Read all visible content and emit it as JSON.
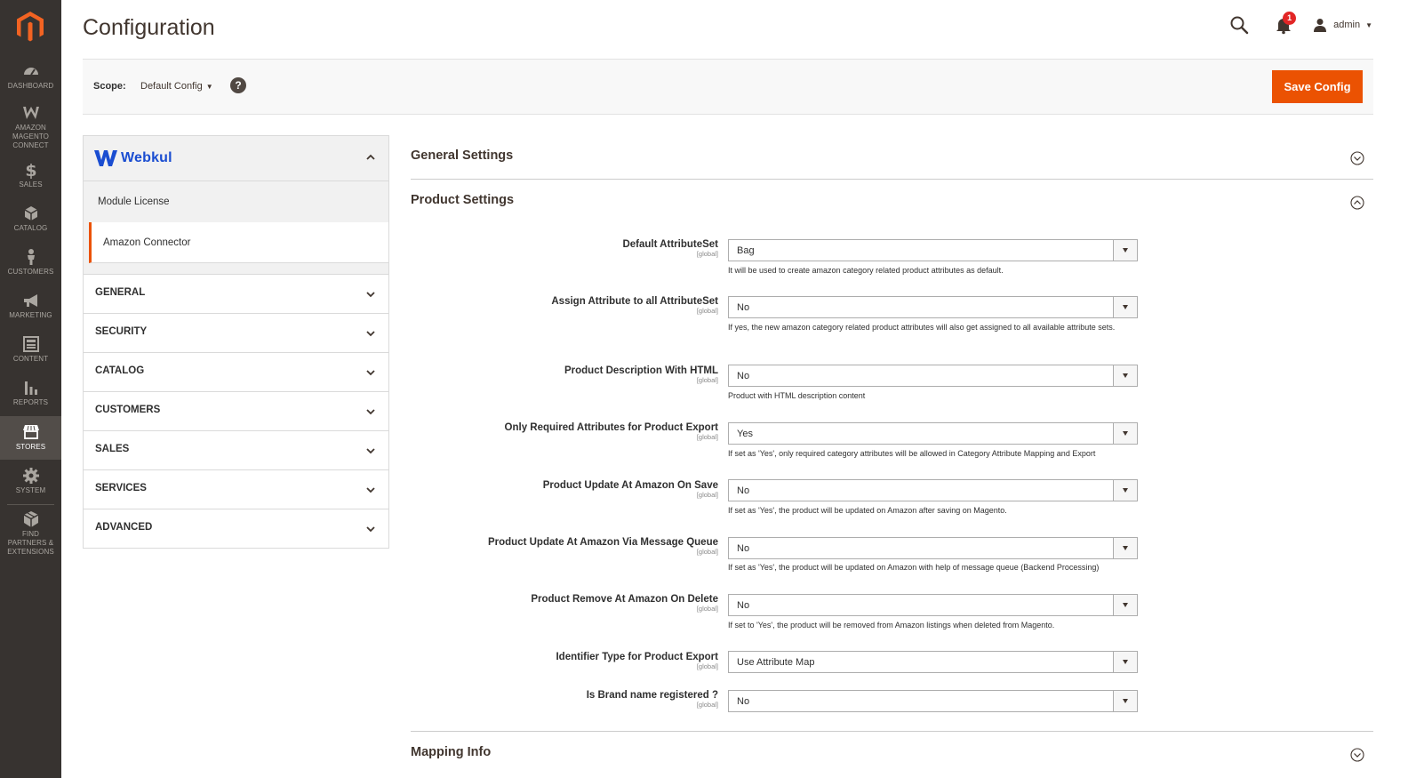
{
  "page": {
    "title": "Configuration"
  },
  "admin_menu": [
    {
      "key": "dashboard",
      "label": "DASHBOARD",
      "icon": "dashboard-icon"
    },
    {
      "key": "amazon",
      "label": "AMAZON MAGENTO CONNECT",
      "icon": "amazon-connect-icon"
    },
    {
      "key": "sales",
      "label": "SALES",
      "icon": "dollar-icon"
    },
    {
      "key": "catalog",
      "label": "CATALOG",
      "icon": "box-icon"
    },
    {
      "key": "customers",
      "label": "CUSTOMERS",
      "icon": "person-icon"
    },
    {
      "key": "marketing",
      "label": "MARKETING",
      "icon": "megaphone-icon"
    },
    {
      "key": "content",
      "label": "CONTENT",
      "icon": "content-icon"
    },
    {
      "key": "reports",
      "label": "REPORTS",
      "icon": "bar-chart-icon"
    },
    {
      "key": "stores",
      "label": "STORES",
      "icon": "store-icon",
      "active": true
    },
    {
      "key": "system",
      "label": "SYSTEM",
      "icon": "gear-icon"
    },
    {
      "key": "partners",
      "label": "FIND PARTNERS & EXTENSIONS",
      "icon": "extensions-icon"
    }
  ],
  "header": {
    "notifications_count": "1",
    "user_name": "admin"
  },
  "scope": {
    "label": "Scope:",
    "value": "Default Config",
    "help": "?",
    "save_label": "Save Config"
  },
  "tabs": {
    "brand": "Webkul",
    "sub_items": [
      "Module License",
      "Amazon Connector"
    ],
    "active_sub_item": "Amazon Connector",
    "sections": [
      "GENERAL",
      "SECURITY",
      "CATALOG",
      "CUSTOMERS",
      "SALES",
      "SERVICES",
      "ADVANCED"
    ]
  },
  "main": {
    "general_settings": "General Settings",
    "product_settings": "Product Settings",
    "mapping_info": "Mapping Info",
    "scope_tag": "[global]",
    "fields": [
      {
        "label": "Default AttributeSet",
        "value": "Bag",
        "note": "It will be used to create amazon category related product attributes as default."
      },
      {
        "label": "Assign Attribute to all AttributeSet",
        "value": "No",
        "note": "If yes, the new amazon category related product attributes will also get assigned to all available attribute sets."
      },
      {
        "label": "Product Description With HTML",
        "value": "No",
        "note": "Product with HTML description content"
      },
      {
        "label": "Only Required Attributes for Product Export",
        "value": "Yes",
        "note": "If set as 'Yes', only required category attributes will be allowed in Category Attribute Mapping and Export"
      },
      {
        "label": "Product Update At Amazon On Save",
        "value": "No",
        "note": "If set as 'Yes', the product will be updated on Amazon after saving on Magento."
      },
      {
        "label": "Product Update At Amazon Via Message Queue",
        "value": "No",
        "note": "If set as 'Yes', the product will be updated on Amazon with help of message queue (Backend Processing)"
      },
      {
        "label": "Product Remove At Amazon On Delete",
        "value": "No",
        "note": "If set to 'Yes', the product will be removed from Amazon listings when deleted from Magento."
      },
      {
        "label": "Identifier Type for Product Export",
        "value": "Use Attribute Map",
        "note": ""
      },
      {
        "label": "Is Brand name registered ?",
        "value": "No",
        "note": ""
      }
    ]
  },
  "colors": {
    "accent": "#eb5202",
    "menu_bg": "#373330",
    "brand_blue": "#1a4dd1"
  }
}
